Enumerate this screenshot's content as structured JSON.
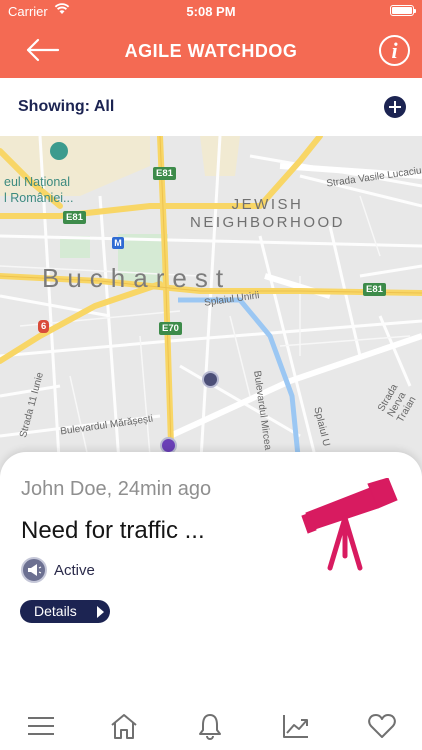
{
  "status_bar": {
    "carrier": "Carrier",
    "time": "5:08 PM"
  },
  "header": {
    "title": "AGILE WATCHDOG",
    "back_icon": "arrow-left-icon",
    "info_icon": "info-icon",
    "info_glyph": "i",
    "color": "#f46a53"
  },
  "filter": {
    "label": "Showing: All",
    "add_icon": "plus-circle-icon"
  },
  "map": {
    "labels": {
      "museum_line1": "eul Național",
      "museum_line2": "l României...",
      "jewish_line1": "JEWISH",
      "jewish_line2": "NEIGHBORHOOD",
      "city": "Bucharest",
      "splaiul_unirii": "Splaiul Unirii",
      "bulevardul": "Bulevardul Mircea Vodă",
      "splaiul_u": "Splaiul U",
      "strada_vasile": "Strada Vasile Lucaciu",
      "strada_nerva": "Strada Nerva Traian",
      "strada_11": "Strada 11 Iunie",
      "marasesti": "Bulevardul Mărășești"
    },
    "shields": {
      "e81_a": "E81",
      "e81_b": "E81",
      "e81_c": "E81",
      "e70": "E70",
      "route6": "6"
    },
    "metro": "M"
  },
  "card": {
    "meta": "John Doe, 24min ago",
    "title": "Need for traffic ...",
    "status": "Active",
    "details_label": "Details",
    "status_icon": "megaphone-icon",
    "illustration_icon": "telescope-icon"
  },
  "tabbar": {
    "items": [
      "menu-icon",
      "home-icon",
      "bell-icon",
      "trend-chart-icon",
      "heart-icon"
    ]
  },
  "colors": {
    "accent": "#f46a53",
    "navy": "#1c2452",
    "telescope": "#d81b60"
  }
}
